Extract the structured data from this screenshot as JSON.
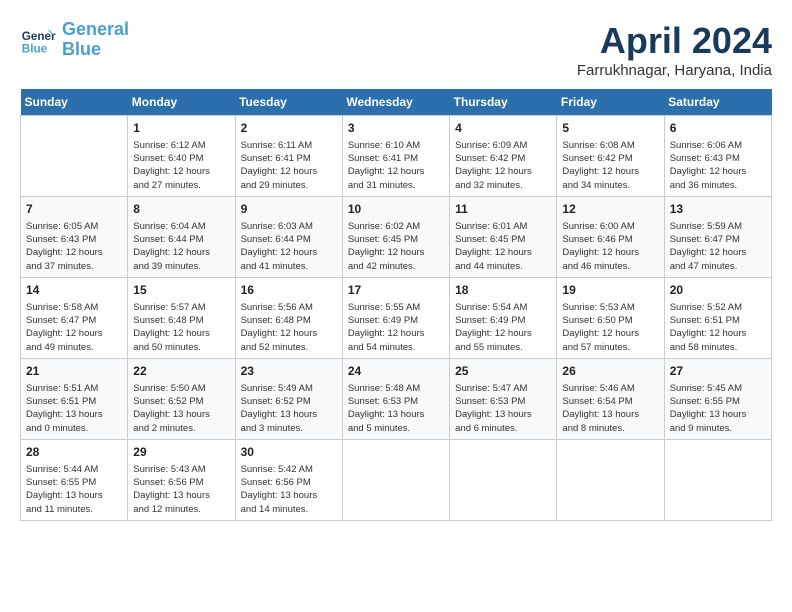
{
  "header": {
    "logo_line1": "General",
    "logo_line2": "Blue",
    "month": "April 2024",
    "location": "Farrukhnagar, Haryana, India"
  },
  "days_of_week": [
    "Sunday",
    "Monday",
    "Tuesday",
    "Wednesday",
    "Thursday",
    "Friday",
    "Saturday"
  ],
  "weeks": [
    [
      {
        "num": "",
        "info": ""
      },
      {
        "num": "1",
        "info": "Sunrise: 6:12 AM\nSunset: 6:40 PM\nDaylight: 12 hours\nand 27 minutes."
      },
      {
        "num": "2",
        "info": "Sunrise: 6:11 AM\nSunset: 6:41 PM\nDaylight: 12 hours\nand 29 minutes."
      },
      {
        "num": "3",
        "info": "Sunrise: 6:10 AM\nSunset: 6:41 PM\nDaylight: 12 hours\nand 31 minutes."
      },
      {
        "num": "4",
        "info": "Sunrise: 6:09 AM\nSunset: 6:42 PM\nDaylight: 12 hours\nand 32 minutes."
      },
      {
        "num": "5",
        "info": "Sunrise: 6:08 AM\nSunset: 6:42 PM\nDaylight: 12 hours\nand 34 minutes."
      },
      {
        "num": "6",
        "info": "Sunrise: 6:06 AM\nSunset: 6:43 PM\nDaylight: 12 hours\nand 36 minutes."
      }
    ],
    [
      {
        "num": "7",
        "info": "Sunrise: 6:05 AM\nSunset: 6:43 PM\nDaylight: 12 hours\nand 37 minutes."
      },
      {
        "num": "8",
        "info": "Sunrise: 6:04 AM\nSunset: 6:44 PM\nDaylight: 12 hours\nand 39 minutes."
      },
      {
        "num": "9",
        "info": "Sunrise: 6:03 AM\nSunset: 6:44 PM\nDaylight: 12 hours\nand 41 minutes."
      },
      {
        "num": "10",
        "info": "Sunrise: 6:02 AM\nSunset: 6:45 PM\nDaylight: 12 hours\nand 42 minutes."
      },
      {
        "num": "11",
        "info": "Sunrise: 6:01 AM\nSunset: 6:45 PM\nDaylight: 12 hours\nand 44 minutes."
      },
      {
        "num": "12",
        "info": "Sunrise: 6:00 AM\nSunset: 6:46 PM\nDaylight: 12 hours\nand 46 minutes."
      },
      {
        "num": "13",
        "info": "Sunrise: 5:59 AM\nSunset: 6:47 PM\nDaylight: 12 hours\nand 47 minutes."
      }
    ],
    [
      {
        "num": "14",
        "info": "Sunrise: 5:58 AM\nSunset: 6:47 PM\nDaylight: 12 hours\nand 49 minutes."
      },
      {
        "num": "15",
        "info": "Sunrise: 5:57 AM\nSunset: 6:48 PM\nDaylight: 12 hours\nand 50 minutes."
      },
      {
        "num": "16",
        "info": "Sunrise: 5:56 AM\nSunset: 6:48 PM\nDaylight: 12 hours\nand 52 minutes."
      },
      {
        "num": "17",
        "info": "Sunrise: 5:55 AM\nSunset: 6:49 PM\nDaylight: 12 hours\nand 54 minutes."
      },
      {
        "num": "18",
        "info": "Sunrise: 5:54 AM\nSunset: 6:49 PM\nDaylight: 12 hours\nand 55 minutes."
      },
      {
        "num": "19",
        "info": "Sunrise: 5:53 AM\nSunset: 6:50 PM\nDaylight: 12 hours\nand 57 minutes."
      },
      {
        "num": "20",
        "info": "Sunrise: 5:52 AM\nSunset: 6:51 PM\nDaylight: 12 hours\nand 58 minutes."
      }
    ],
    [
      {
        "num": "21",
        "info": "Sunrise: 5:51 AM\nSunset: 6:51 PM\nDaylight: 13 hours\nand 0 minutes."
      },
      {
        "num": "22",
        "info": "Sunrise: 5:50 AM\nSunset: 6:52 PM\nDaylight: 13 hours\nand 2 minutes."
      },
      {
        "num": "23",
        "info": "Sunrise: 5:49 AM\nSunset: 6:52 PM\nDaylight: 13 hours\nand 3 minutes."
      },
      {
        "num": "24",
        "info": "Sunrise: 5:48 AM\nSunset: 6:53 PM\nDaylight: 13 hours\nand 5 minutes."
      },
      {
        "num": "25",
        "info": "Sunrise: 5:47 AM\nSunset: 6:53 PM\nDaylight: 13 hours\nand 6 minutes."
      },
      {
        "num": "26",
        "info": "Sunrise: 5:46 AM\nSunset: 6:54 PM\nDaylight: 13 hours\nand 8 minutes."
      },
      {
        "num": "27",
        "info": "Sunrise: 5:45 AM\nSunset: 6:55 PM\nDaylight: 13 hours\nand 9 minutes."
      }
    ],
    [
      {
        "num": "28",
        "info": "Sunrise: 5:44 AM\nSunset: 6:55 PM\nDaylight: 13 hours\nand 11 minutes."
      },
      {
        "num": "29",
        "info": "Sunrise: 5:43 AM\nSunset: 6:56 PM\nDaylight: 13 hours\nand 12 minutes."
      },
      {
        "num": "30",
        "info": "Sunrise: 5:42 AM\nSunset: 6:56 PM\nDaylight: 13 hours\nand 14 minutes."
      },
      {
        "num": "",
        "info": ""
      },
      {
        "num": "",
        "info": ""
      },
      {
        "num": "",
        "info": ""
      },
      {
        "num": "",
        "info": ""
      }
    ]
  ]
}
